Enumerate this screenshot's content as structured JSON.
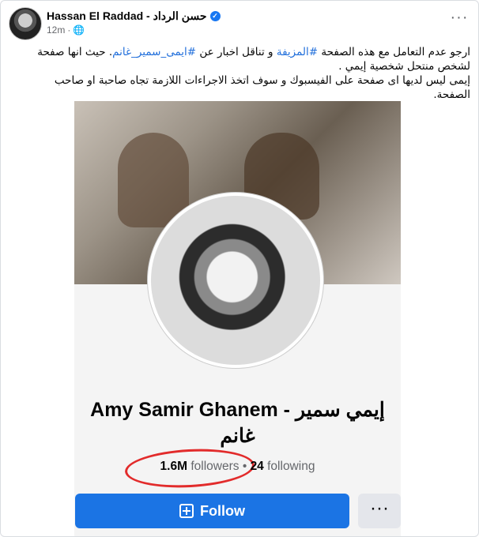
{
  "post": {
    "author": "Hassan El Raddad - حسن الرداد",
    "time": "12m",
    "separator": "·",
    "privacy_icon": "globe-icon",
    "verified_icon": "verified-icon",
    "more_icon": "more-icon",
    "text_line1_a": "ارجو عدم التعامل مع هذه الصفحة ",
    "hashtag1": "#المزيفة",
    "text_line1_b": " و تناقل اخبار عن ",
    "hashtag2": "#ايمى_سمير_غانم",
    "text_line1_c": ". حيث انها صفحة لشخص منتحل شخصية إيمي .",
    "text_line2": "إيمى ليس لديها اى صفحة على الفيسبوك و سوف اتخذ الاجراءات اللازمة تجاه صاحبة او صاحب الصفحة."
  },
  "shared_profile": {
    "name": "Amy Samir Ghanem - إيمي سمير غانم",
    "followers_count": "1.6M",
    "followers_label": "followers",
    "separator": "•",
    "following_count": "24",
    "following_label": "following",
    "follow_label": "Follow",
    "more_label": "···",
    "follow_icon": "plus-square-icon"
  },
  "colors": {
    "accent": "#1b74e4",
    "annotation": "#e22b2b"
  }
}
